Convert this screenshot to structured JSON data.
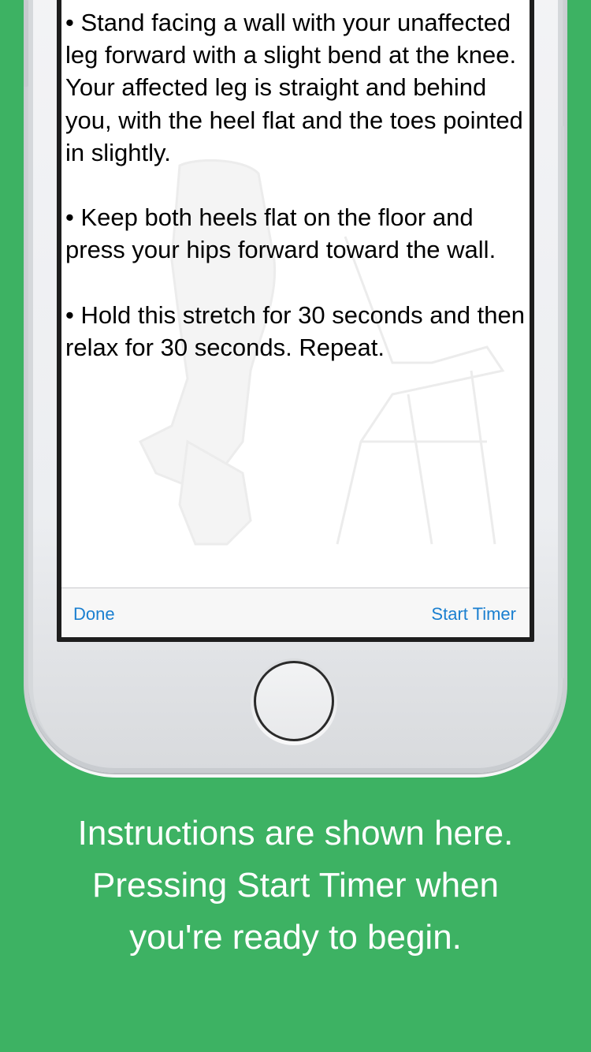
{
  "app": {
    "instructions": [
      "• Stand facing a wall with your unaffected leg forward with a slight bend at the knee. Your affected leg is straight and behind you, with the heel flat and the toes pointed in slightly.",
      "• Keep both heels flat on the floor and press your hips forward toward the wall.",
      "• Hold this stretch for 30 seconds and then relax for 30 seconds. Repeat."
    ],
    "toolbar": {
      "done_label": "Done",
      "start_timer_label": "Start Timer"
    }
  },
  "caption": {
    "lines": [
      "Instructions are shown here.",
      "Pressing Start Timer when",
      "you're ready to begin."
    ]
  },
  "colors": {
    "background": "#3db263",
    "accent": "#1a7fd0",
    "caption_text": "#ffffff"
  }
}
